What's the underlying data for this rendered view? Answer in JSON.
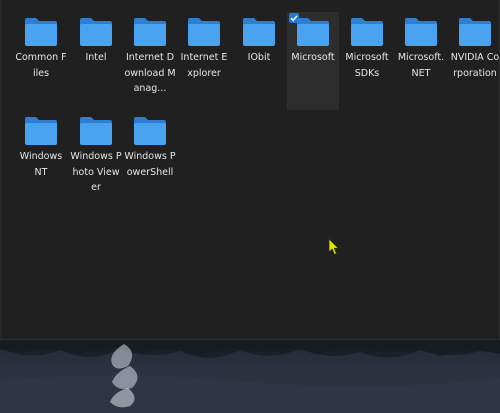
{
  "folders": [
    {
      "label": "Common Files",
      "selected": false
    },
    {
      "label": "Intel",
      "selected": false
    },
    {
      "label": "Internet Download Manag...",
      "selected": false
    },
    {
      "label": "Internet Explorer",
      "selected": false
    },
    {
      "label": "IObit",
      "selected": false
    },
    {
      "label": "Microsoft",
      "selected": true
    },
    {
      "label": "Microsoft SDKs",
      "selected": false
    },
    {
      "label": "Microsoft.NET",
      "selected": false
    },
    {
      "label": "NVIDIA Corporation",
      "selected": false
    },
    {
      "label": "Windows NT",
      "selected": false
    },
    {
      "label": "Windows Photo Viewer",
      "selected": false
    },
    {
      "label": "Windows PowerShell",
      "selected": false
    }
  ],
  "colors": {
    "folder_front": "#4aa3f0",
    "folder_back": "#2e7fd1",
    "window_bg": "#202020",
    "selection_bg": "#2d2d2d",
    "checkbox": "#1f7ad8",
    "cursor": "#e6e600"
  },
  "icons": {
    "folder": "folder-icon",
    "cursor": "arrow-cursor-icon",
    "checkbox": "checkbox-checked-icon"
  }
}
